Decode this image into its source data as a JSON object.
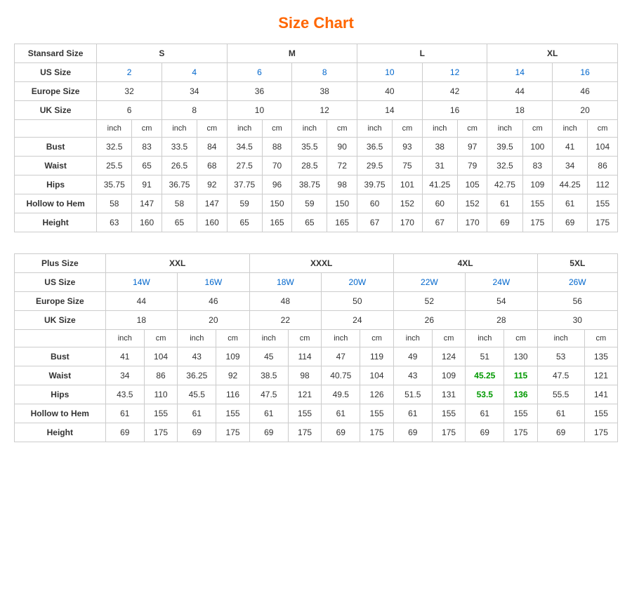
{
  "title": "Size Chart",
  "standard": {
    "table_title": "Standard Size",
    "sizes": [
      "S",
      "M",
      "L",
      "XL"
    ],
    "size_cols": [
      {
        "label": "S",
        "colspan": 4
      },
      {
        "label": "M",
        "colspan": 4
      },
      {
        "label": "L",
        "colspan": 4
      },
      {
        "label": "XL",
        "colspan": 4
      }
    ],
    "us_sizes": [
      "2",
      "4",
      "6",
      "8",
      "10",
      "12",
      "14",
      "16"
    ],
    "europe_sizes": [
      "32",
      "34",
      "36",
      "38",
      "40",
      "42",
      "44",
      "46"
    ],
    "uk_sizes": [
      "6",
      "8",
      "10",
      "12",
      "14",
      "16",
      "18",
      "20"
    ],
    "sub_headers": [
      "inch",
      "cm",
      "inch",
      "cm",
      "inch",
      "cm",
      "inch",
      "cm",
      "inch",
      "cm",
      "inch",
      "cm",
      "inch",
      "cm",
      "inch",
      "cm"
    ],
    "measurements": {
      "bust": [
        "32.5",
        "83",
        "33.5",
        "84",
        "34.5",
        "88",
        "35.5",
        "90",
        "36.5",
        "93",
        "38",
        "97",
        "39.5",
        "100",
        "41",
        "104"
      ],
      "waist": [
        "25.5",
        "65",
        "26.5",
        "68",
        "27.5",
        "70",
        "28.5",
        "72",
        "29.5",
        "75",
        "31",
        "79",
        "32.5",
        "83",
        "34",
        "86"
      ],
      "hips": [
        "35.75",
        "91",
        "36.75",
        "92",
        "37.75",
        "96",
        "38.75",
        "98",
        "39.75",
        "101",
        "41.25",
        "105",
        "42.75",
        "109",
        "44.25",
        "112"
      ],
      "hollow_to_hem": [
        "58",
        "147",
        "58",
        "147",
        "59",
        "150",
        "59",
        "150",
        "60",
        "152",
        "60",
        "152",
        "61",
        "155",
        "61",
        "155"
      ],
      "height": [
        "63",
        "160",
        "65",
        "160",
        "65",
        "165",
        "65",
        "165",
        "67",
        "170",
        "67",
        "170",
        "69",
        "175",
        "69",
        "175"
      ]
    },
    "row_labels": {
      "stansard_size": "Stansard Size",
      "us_size": "US Size",
      "europe_size": "Europe Size",
      "uk_size": "UK Size",
      "bust": "Bust",
      "waist": "Waist",
      "hips": "Hips",
      "hollow_to_hem": "Hollow to Hem",
      "height": "Height"
    }
  },
  "plus": {
    "table_title": "Plus Size",
    "size_cols": [
      {
        "label": "XXL",
        "colspan": 4
      },
      {
        "label": "XXXL",
        "colspan": 4
      },
      {
        "label": "4XL",
        "colspan": 4
      },
      {
        "label": "5XL",
        "colspan": 2
      }
    ],
    "us_sizes": [
      "14W",
      "16W",
      "18W",
      "20W",
      "22W",
      "24W",
      "26W"
    ],
    "europe_sizes": [
      "44",
      "46",
      "48",
      "50",
      "52",
      "54",
      "56"
    ],
    "uk_sizes": [
      "18",
      "20",
      "22",
      "24",
      "26",
      "28",
      "30"
    ],
    "sub_headers": [
      "inch",
      "cm",
      "inch",
      "cm",
      "inch",
      "cm",
      "inch",
      "cm",
      "inch",
      "cm",
      "inch",
      "cm",
      "inch",
      "cm"
    ],
    "measurements": {
      "bust": [
        "41",
        "104",
        "43",
        "109",
        "45",
        "114",
        "47",
        "119",
        "49",
        "124",
        "51",
        "130",
        "53",
        "135"
      ],
      "waist": [
        "34",
        "86",
        "36.25",
        "92",
        "38.5",
        "98",
        "40.75",
        "104",
        "43",
        "109",
        "45.25",
        "115",
        "47.5",
        "121"
      ],
      "hips": [
        "43.5",
        "110",
        "45.5",
        "116",
        "47.5",
        "121",
        "49.5",
        "126",
        "51.5",
        "131",
        "53.5",
        "136",
        "55.5",
        "141"
      ],
      "hollow_to_hem": [
        "61",
        "155",
        "61",
        "155",
        "61",
        "155",
        "61",
        "155",
        "61",
        "155",
        "61",
        "155",
        "61",
        "155"
      ],
      "height": [
        "69",
        "175",
        "69",
        "175",
        "69",
        "175",
        "69",
        "175",
        "69",
        "175",
        "69",
        "175",
        "69",
        "175"
      ]
    },
    "row_labels": {
      "plus_size": "Plus Size",
      "us_size": "US Size",
      "europe_size": "Europe Size",
      "uk_size": "UK Size",
      "bust": "Bust",
      "waist": "Waist",
      "hips": "Hips",
      "hollow_to_hem": "Hollow to Hem",
      "height": "Height"
    }
  }
}
